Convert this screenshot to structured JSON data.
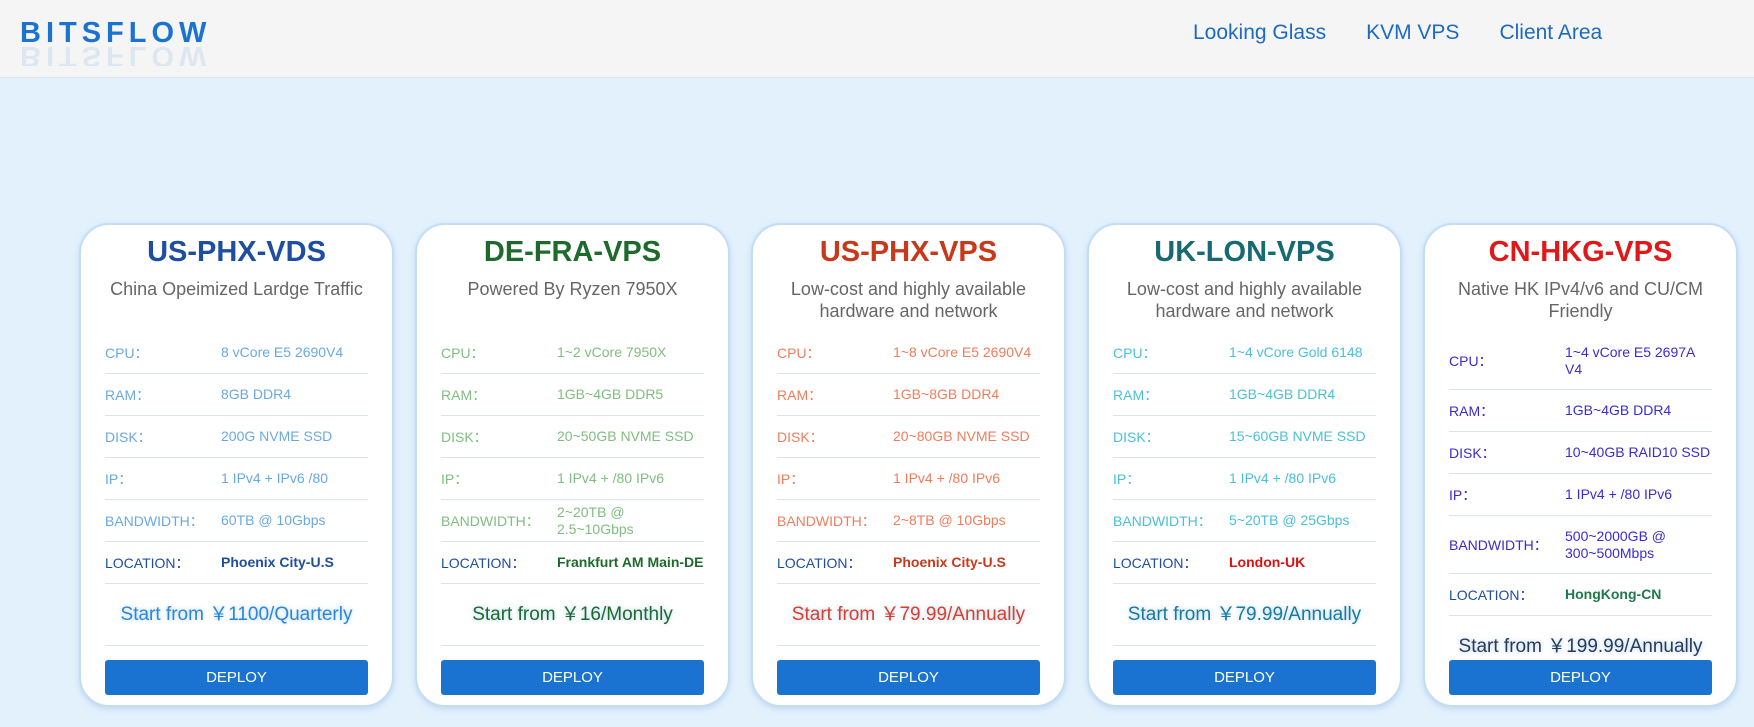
{
  "header": {
    "logo": "BITSFLOW",
    "nav": [
      "Looking Glass",
      "KVM VPS",
      "Client Area"
    ]
  },
  "cards": [
    {
      "title": "US-PHX-VDS",
      "subtitle": "China Opeimized Lardge Traffic",
      "title_color": "#1e4ea0",
      "spec_color": "#6aa9e0",
      "location_label_color": "#1e4ea0",
      "location_value_color": "#1e4ea0",
      "price_color": "#2c86d9",
      "specs": [
        {
          "label": "CPU：",
          "value": "8 vCore E5 2690V4"
        },
        {
          "label": "RAM：",
          "value": "8GB DDR4"
        },
        {
          "label": "DISK：",
          "value": "200G NVME SSD"
        },
        {
          "label": "IP：",
          "value": "1 IPv4 + IPv6 /80"
        },
        {
          "label": "BANDWIDTH：",
          "value": "60TB @ 10Gbps"
        },
        {
          "label": "LOCATION：",
          "value": "Phoenix City-U.S"
        }
      ],
      "price": "Start from ￥1100/Quarterly",
      "deploy": "DEPLOY"
    },
    {
      "title": "DE-FRA-VPS",
      "subtitle": "Powered By Ryzen 7950X",
      "title_color": "#1d6a2a",
      "spec_color": "#7fbe7f",
      "location_label_color": "#1e4ea0",
      "location_value_color": "#1d6a2a",
      "price_color": "#1d6a2a",
      "specs": [
        {
          "label": "CPU：",
          "value": "1~2 vCore 7950X"
        },
        {
          "label": "RAM：",
          "value": "1GB~4GB DDR5"
        },
        {
          "label": "DISK：",
          "value": "20~50GB NVME SSD"
        },
        {
          "label": "IP：",
          "value": "1 IPv4 + /80 IPv6"
        },
        {
          "label": "BANDWIDTH：",
          "value": "2~20TB @ 2.5~10Gbps"
        },
        {
          "label": "LOCATION：",
          "value": "Frankfurt AM Main-DE"
        }
      ],
      "price": "Start from ￥16/Monthly",
      "deploy": "DEPLOY"
    },
    {
      "title": "US-PHX-VPS",
      "subtitle": "Low-cost and highly available hardware and network",
      "title_color": "#c8381a",
      "spec_color": "#ef7d5c",
      "location_label_color": "#1e4ea0",
      "location_value_color": "#c8381a",
      "price_color": "#d8402a",
      "specs": [
        {
          "label": "CPU：",
          "value": "1~8 vCore E5 2690V4"
        },
        {
          "label": "RAM：",
          "value": "1GB~8GB DDR4"
        },
        {
          "label": "DISK：",
          "value": "20~80GB NVME SSD"
        },
        {
          "label": "IP：",
          "value": "1 IPv4 + /80 IPv6"
        },
        {
          "label": "BANDWIDTH：",
          "value": "2~8TB @ 10Gbps"
        },
        {
          "label": "LOCATION：",
          "value": "Phoenix City-U.S"
        }
      ],
      "price": "Start from ￥79.99/Annually",
      "deploy": "DEPLOY"
    },
    {
      "title": "UK-LON-VPS",
      "subtitle": "Low-cost and highly available hardware and network",
      "title_color": "#176a72",
      "spec_color": "#49c0d8",
      "location_label_color": "#1e4ea0",
      "location_value_color": "#e01010",
      "price_color": "#1a7aa0",
      "specs": [
        {
          "label": "CPU：",
          "value": "1~4 vCore Gold 6148"
        },
        {
          "label": "RAM：",
          "value": "1GB~4GB DDR4"
        },
        {
          "label": "DISK：",
          "value": "15~60GB NVME SSD"
        },
        {
          "label": "IP：",
          "value": "1 IPv4 + /80 IPv6"
        },
        {
          "label": "BANDWIDTH：",
          "value": "5~20TB @ 25Gbps"
        },
        {
          "label": "LOCATION：",
          "value": "London-UK"
        }
      ],
      "price": "Start from ￥79.99/Annually",
      "deploy": "DEPLOY"
    },
    {
      "title": "CN-HKG-VPS",
      "subtitle": "Native HK IPv4/v6 and CU/CM Friendly",
      "title_color": "#e01818",
      "spec_color": "#3a2bd0",
      "location_label_color": "#1e4ea0",
      "location_value_color": "#1d7a4a",
      "price_color": "#2c3a5a",
      "specs": [
        {
          "label": "CPU：",
          "value": "1~4 vCore E5 2697A V4"
        },
        {
          "label": "RAM：",
          "value": "1GB~4GB DDR4"
        },
        {
          "label": "DISK：",
          "value": "10~40GB RAID10 SSD"
        },
        {
          "label": "IP：",
          "value": "1 IPv4 + /80 IPv6"
        },
        {
          "label": "BANDWIDTH：",
          "value": "500~2000GB @ 300~500Mbps"
        },
        {
          "label": "LOCATION：",
          "value": "HongKong-CN"
        }
      ],
      "price": "Start from ￥199.99/Annually",
      "deploy": "DEPLOY"
    }
  ]
}
